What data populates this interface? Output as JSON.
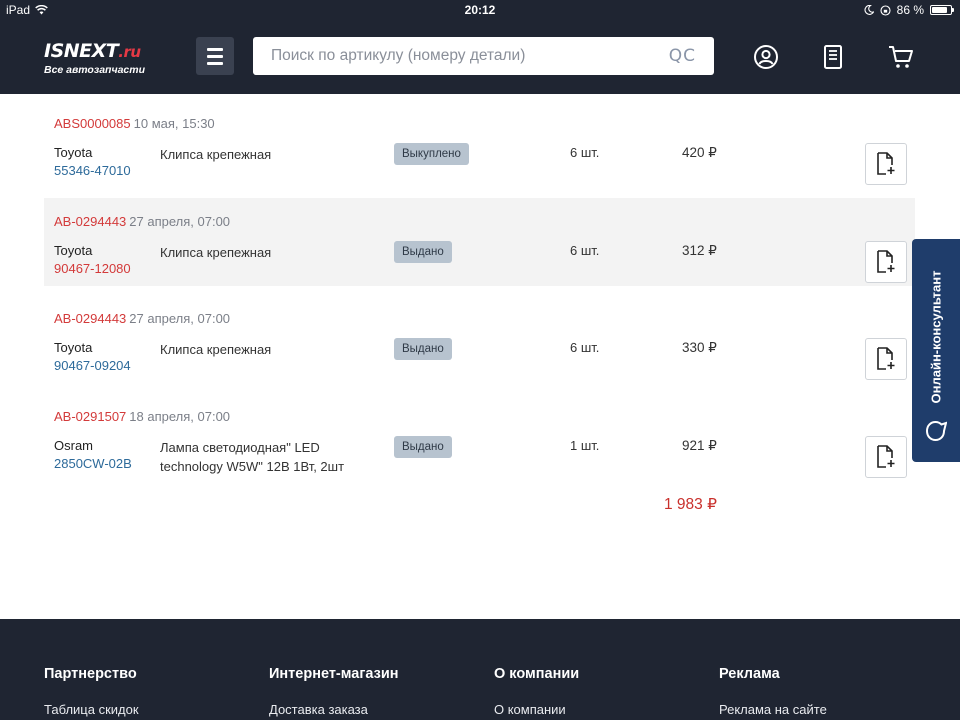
{
  "status_bar": {
    "device": "iPad",
    "time": "20:12",
    "battery": "86 %",
    "battery_level": 0.86
  },
  "header": {
    "logo_main": "ISNEXT",
    "logo_tld": ".ru",
    "logo_tagline": "Все автозапчасти",
    "search_placeholder": "Поиск по артикулу (номеру детали)",
    "search_value": "",
    "search_badge": "QC",
    "icons": [
      "menu-icon",
      "user-icon",
      "notebook-icon",
      "cart-icon"
    ]
  },
  "orders": [
    {
      "number": "ABS0000085",
      "date": "10 мая, 15:30",
      "brand": "Toyota",
      "article": "55346-47010",
      "article_color": "#2d6a9a",
      "name": "Клипса крепежная",
      "status": "Выкуплено",
      "qty": "6 шт.",
      "price": "420 ₽"
    },
    {
      "number": "AB-0294443",
      "date": "27 апреля, 07:00",
      "brand": "Toyota",
      "article": "90467-12080",
      "article_color": "#d33a3a",
      "name": "Клипса крепежная",
      "status": "Выдано",
      "qty": "6 шт.",
      "price": "312 ₽"
    },
    {
      "number": "AB-0294443",
      "date": "27 апреля, 07:00",
      "brand": "Toyota",
      "article": "90467-09204",
      "article_color": "#2d6a9a",
      "name": "Клипса крепежная",
      "status": "Выдано",
      "qty": "6 шт.",
      "price": "330 ₽"
    },
    {
      "number": "AB-0291507",
      "date": "18 апреля, 07:00",
      "brand": "Osram",
      "article": "2850CW-02B",
      "article_color": "#2d6a9a",
      "name": "Лампа светодиодная\" LED technology W5W\" 12В 1Вт, 2шт",
      "status": "Выдано",
      "qty": "1 шт.",
      "price": "921 ₽"
    }
  ],
  "total": "1 983 ₽",
  "side_tab": {
    "label": "Онлайн-консультант"
  },
  "footer": {
    "columns": [
      {
        "title": "Партнерство",
        "link": "Таблица скидок"
      },
      {
        "title": "Интернет-магазин",
        "link": "Доставка заказа"
      },
      {
        "title": "О компании",
        "link": "О компании"
      },
      {
        "title": "Реклама",
        "link": "Реклама на сайте"
      }
    ]
  },
  "colors": {
    "dark_bg": "#1f2532",
    "accent_red": "#d33a3a",
    "link_blue": "#2d6a9a",
    "badge_bg": "#b7c3cf",
    "side_tab_bg": "#1f3d6b"
  }
}
